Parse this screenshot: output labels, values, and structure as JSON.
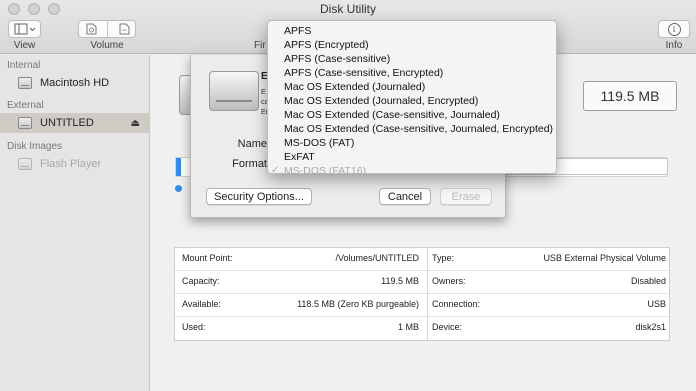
{
  "window": {
    "title": "Disk Utility"
  },
  "toolbar": {
    "view_label": "View",
    "volume_label": "Volume",
    "first_aid_label_partial": "Fir",
    "info_label": "Info",
    "info_icon": "i"
  },
  "sidebar": {
    "sections": [
      {
        "header": "Internal",
        "items": [
          {
            "label": "Macintosh HD",
            "icon": "disk-icon"
          }
        ]
      },
      {
        "header": "External",
        "items": [
          {
            "label": "UNTITLED",
            "icon": "disk-icon",
            "selected": true,
            "eject": "⏏"
          }
        ]
      },
      {
        "header": "Disk Images",
        "items": [
          {
            "label": "Flash Player",
            "icon": "disk-icon",
            "disabled": true
          }
        ]
      }
    ]
  },
  "main": {
    "capacity": "119.5 MB",
    "usage_fraction": 0.01,
    "accent_color": "#2f8cf0",
    "info": {
      "left": [
        {
          "label": "Mount Point:",
          "value": "/Volumes/UNTITLED"
        },
        {
          "label": "Capacity:",
          "value": "119.5 MB"
        },
        {
          "label": "Available:",
          "value": "118.5 MB (Zero KB purgeable)"
        },
        {
          "label": "Used:",
          "value": "1 MB"
        }
      ],
      "right": [
        {
          "label": "Type:",
          "value": "USB External Physical Volume"
        },
        {
          "label": "Owners:",
          "value": "Disabled"
        },
        {
          "label": "Connection:",
          "value": "USB"
        },
        {
          "label": "Device:",
          "value": "disk2s1"
        }
      ]
    }
  },
  "sheet": {
    "title_partial": "E",
    "desc_partial": [
      "E",
      "ca",
      "Er"
    ],
    "name_label": "Name",
    "format_label": "Format",
    "security_button": "Security Options...",
    "cancel_button": "Cancel",
    "erase_button": "Erase"
  },
  "format_menu": {
    "items": [
      {
        "label": "APFS"
      },
      {
        "label": "APFS (Encrypted)"
      },
      {
        "label": "APFS (Case-sensitive)"
      },
      {
        "label": "APFS (Case-sensitive, Encrypted)"
      },
      {
        "label": "Mac OS Extended (Journaled)"
      },
      {
        "label": "Mac OS Extended (Journaled, Encrypted)"
      },
      {
        "label": "Mac OS Extended (Case-sensitive, Journaled)"
      },
      {
        "label": "Mac OS Extended (Case-sensitive, Journaled, Encrypted)"
      },
      {
        "label": "MS-DOS (FAT)"
      },
      {
        "label": "ExFAT"
      },
      {
        "label": "MS-DOS (FAT16)",
        "checked": true,
        "disabled": true,
        "check": "✓"
      }
    ]
  }
}
